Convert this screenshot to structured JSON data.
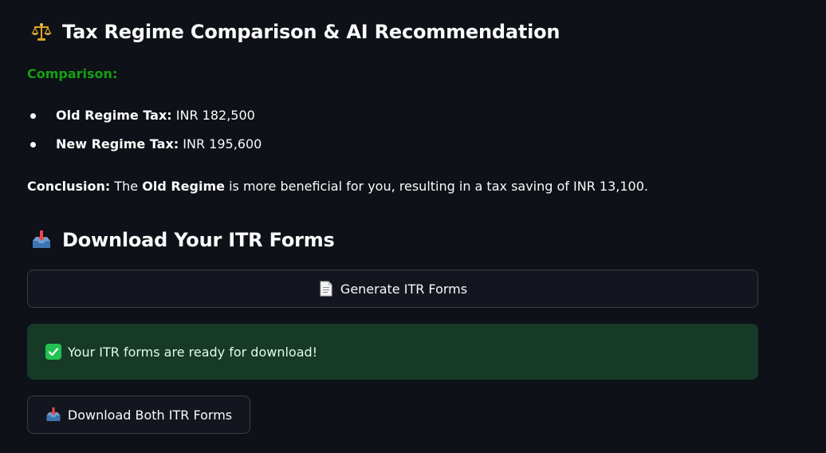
{
  "section1": {
    "title": "Tax Regime Comparison & AI Recommendation",
    "icon": "balance-scale-icon",
    "comparison_label": "Comparison:",
    "items": [
      {
        "label": "Old Regime Tax:",
        "value": "INR 182,500"
      },
      {
        "label": "New Regime Tax:",
        "value": "INR 195,600"
      }
    ],
    "conclusion": {
      "label": "Conclusion:",
      "pre": "The",
      "emphasis": "Old Regime",
      "post": "is more beneficial for you, resulting in a tax saving of INR 13,100."
    }
  },
  "section2": {
    "title": "Download Your ITR Forms",
    "icon": "inbox-tray-icon",
    "generate_button": {
      "label": "Generate ITR Forms",
      "icon": "page-document-icon"
    },
    "success_message": {
      "text": "Your ITR forms are ready for download!",
      "icon": "check-mark-icon"
    },
    "download_button": {
      "label": "Download Both ITR Forms",
      "icon": "inbox-tray-icon"
    }
  },
  "colors": {
    "background": "#0e1117",
    "accent_green_text": "#14a014",
    "success_bg": "#173928",
    "check_green": "#21c354",
    "button_border": "#3a3d46"
  }
}
